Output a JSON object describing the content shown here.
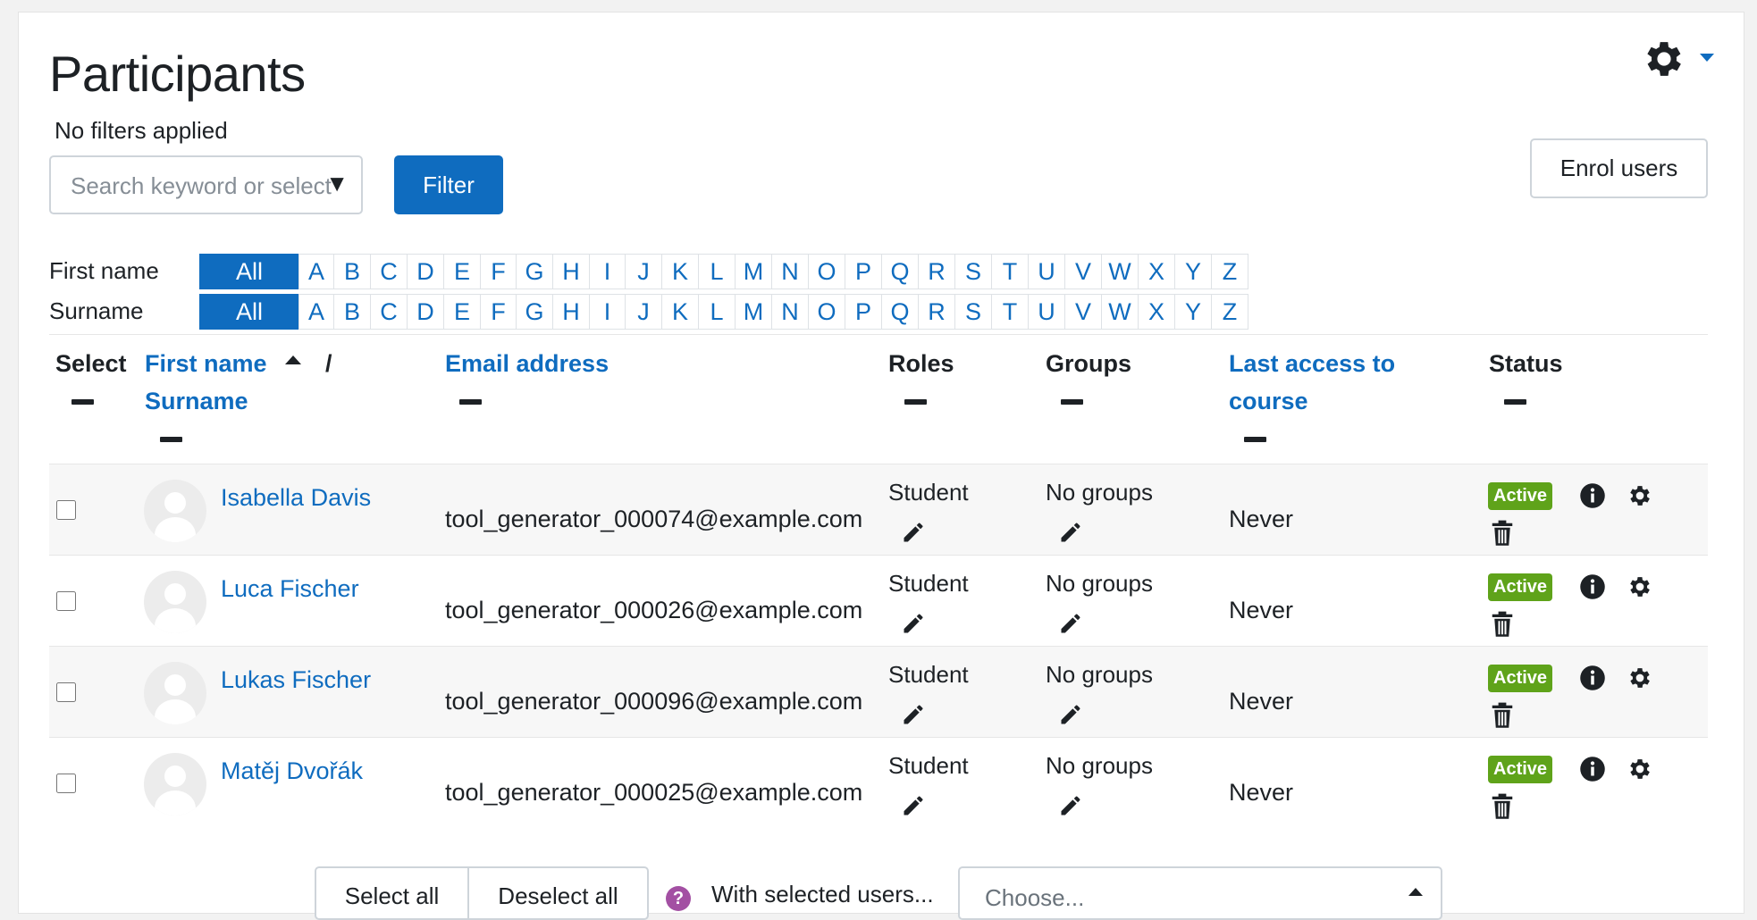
{
  "page": {
    "title": "Participants",
    "filters_note": "No filters applied",
    "search_placeholder": "Search keyword or select filter",
    "filter_button": "Filter",
    "enrol_button": "Enrol users"
  },
  "initials": {
    "firstname_label": "First name",
    "surname_label": "Surname",
    "all_label": "All",
    "letters": [
      "A",
      "B",
      "C",
      "D",
      "E",
      "F",
      "G",
      "H",
      "I",
      "J",
      "K",
      "L",
      "M",
      "N",
      "O",
      "P",
      "Q",
      "R",
      "S",
      "T",
      "U",
      "V",
      "W",
      "X",
      "Y",
      "Z"
    ]
  },
  "table": {
    "headers": {
      "select": "Select",
      "firstname": "First name",
      "slash": "/",
      "surname": "Surname",
      "email": "Email address",
      "roles": "Roles",
      "groups": "Groups",
      "lastaccess_line1": "Last access to",
      "lastaccess_line2": "course",
      "status": "Status"
    },
    "rows": [
      {
        "name": "Isabella Davis",
        "email": "tool_generator_000074@example.com",
        "role": "Student",
        "groups": "No groups",
        "lastaccess": "Never",
        "status": "Active"
      },
      {
        "name": "Luca Fischer",
        "email": "tool_generator_000026@example.com",
        "role": "Student",
        "groups": "No groups",
        "lastaccess": "Never",
        "status": "Active"
      },
      {
        "name": "Lukas Fischer",
        "email": "tool_generator_000096@example.com",
        "role": "Student",
        "groups": "No groups",
        "lastaccess": "Never",
        "status": "Active"
      },
      {
        "name": "Matěj Dvořák",
        "email": "tool_generator_000025@example.com",
        "role": "Student",
        "groups": "No groups",
        "lastaccess": "Never",
        "status": "Active"
      }
    ]
  },
  "bottom": {
    "select_all": "Select all",
    "deselect_all": "Deselect all",
    "help_glyph": "?",
    "with_selected": "With selected users...",
    "choose": "Choose..."
  },
  "colors": {
    "accent": "#0f6cbf",
    "active_badge": "#5fa31a",
    "help_icon": "#a350a3"
  },
  "icons": [
    "gear-icon",
    "caret-down-icon",
    "sort-up-icon",
    "pencil-icon",
    "info-icon",
    "cog-icon",
    "trash-icon",
    "help-icon",
    "user-avatar-icon"
  ]
}
